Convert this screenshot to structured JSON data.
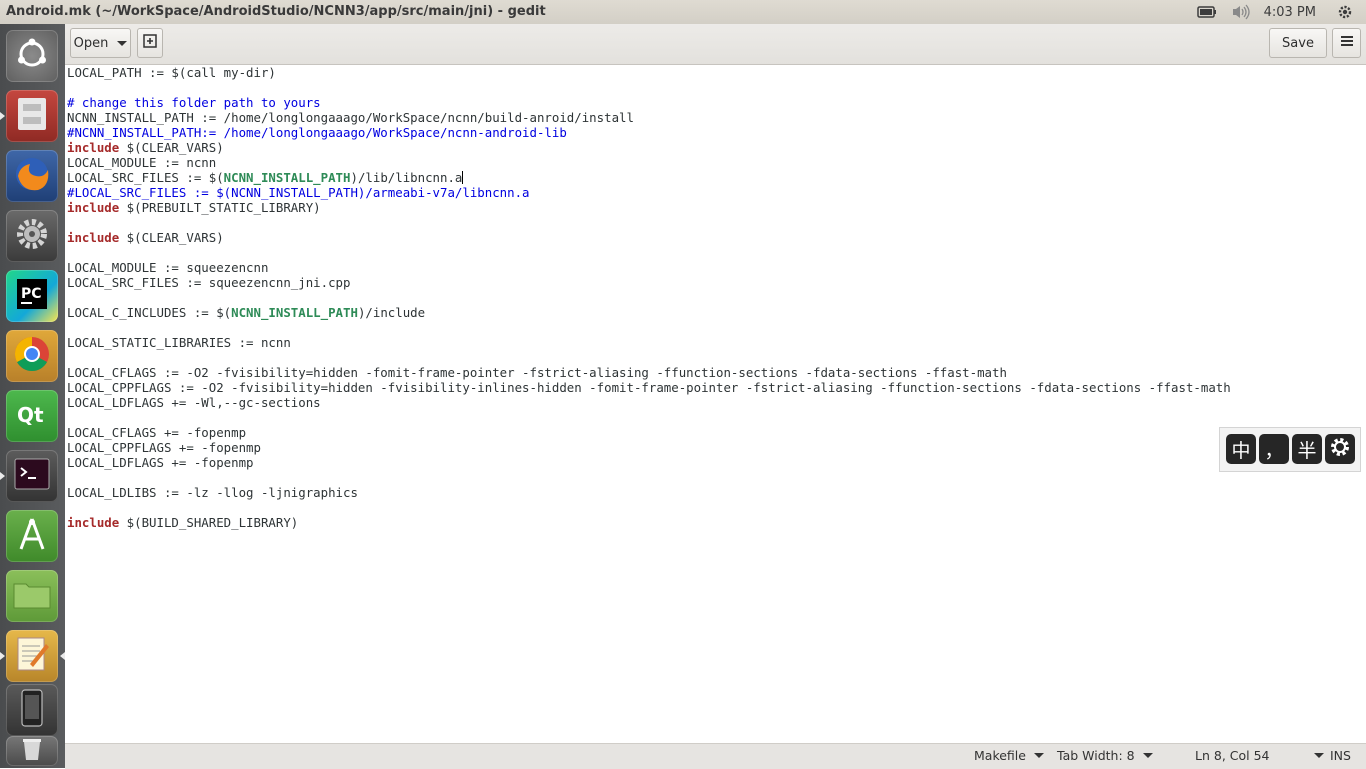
{
  "window": {
    "title": "Android.mk (~/WorkSpace/AndroidStudio/NCNN3/app/src/main/jni) - gedit"
  },
  "top_panel": {
    "clock": "4:03 PM",
    "tray_icons": [
      "battery-icon",
      "volume-icon",
      "settings-icon"
    ]
  },
  "launcher": {
    "items": [
      "ubuntu-dash",
      "files-archive",
      "firefox",
      "system-settings",
      "pycharm",
      "chrome",
      "qt-creator",
      "terminal",
      "android-studio",
      "files",
      "gedit",
      "android-device",
      "trash"
    ]
  },
  "toolbar": {
    "open_label": "Open",
    "save_label": "Save"
  },
  "editor": {
    "lines": [
      [
        {
          "t": "LOCAL_PATH := $(call my-dir)"
        }
      ],
      [
        {
          "t": ""
        }
      ],
      [
        {
          "t": "# change this folder path to yours",
          "c": "cm"
        }
      ],
      [
        {
          "t": "NCNN_INSTALL_PATH := /home/longlongaaago/WorkSpace/ncnn/build-anroid/install"
        }
      ],
      [
        {
          "t": "#NCNN_INSTALL_PATH:= /home/longlongaaago/WorkSpace/ncnn-android-lib",
          "c": "cm"
        }
      ],
      [
        {
          "t": "include",
          "c": "kw"
        },
        {
          "t": " $(CLEAR_VARS)"
        }
      ],
      [
        {
          "t": "LOCAL_MODULE := ncnn"
        }
      ],
      [
        {
          "t": "LOCAL_SRC_FILES := $("
        },
        {
          "t": "NCNN_INSTALL_PATH",
          "c": "var"
        },
        {
          "t": ")/lib/libncnn.a"
        },
        {
          "cursor": true
        }
      ],
      [
        {
          "t": "#LOCAL_SRC_FILES := $(NCNN_INSTALL_PATH)/armeabi-v7a/libncnn.a",
          "c": "cm"
        }
      ],
      [
        {
          "t": "include",
          "c": "kw"
        },
        {
          "t": " $(PREBUILT_STATIC_LIBRARY)"
        }
      ],
      [
        {
          "t": ""
        }
      ],
      [
        {
          "t": "include",
          "c": "kw"
        },
        {
          "t": " $(CLEAR_VARS)"
        }
      ],
      [
        {
          "t": ""
        }
      ],
      [
        {
          "t": "LOCAL_MODULE := squeezencnn"
        }
      ],
      [
        {
          "t": "LOCAL_SRC_FILES := squeezencnn_jni.cpp"
        }
      ],
      [
        {
          "t": ""
        }
      ],
      [
        {
          "t": "LOCAL_C_INCLUDES := $("
        },
        {
          "t": "NCNN_INSTALL_PATH",
          "c": "var"
        },
        {
          "t": ")/include"
        }
      ],
      [
        {
          "t": ""
        }
      ],
      [
        {
          "t": "LOCAL_STATIC_LIBRARIES := ncnn"
        }
      ],
      [
        {
          "t": ""
        }
      ],
      [
        {
          "t": "LOCAL_CFLAGS := -O2 -fvisibility=hidden -fomit-frame-pointer -fstrict-aliasing -ffunction-sections -fdata-sections -ffast-math"
        }
      ],
      [
        {
          "t": "LOCAL_CPPFLAGS := -O2 -fvisibility=hidden -fvisibility-inlines-hidden -fomit-frame-pointer -fstrict-aliasing -ffunction-sections -fdata-sections -ffast-math"
        }
      ],
      [
        {
          "t": "LOCAL_LDFLAGS += -Wl,--gc-sections"
        }
      ],
      [
        {
          "t": ""
        }
      ],
      [
        {
          "t": "LOCAL_CFLAGS += -fopenmp"
        }
      ],
      [
        {
          "t": "LOCAL_CPPFLAGS += -fopenmp"
        }
      ],
      [
        {
          "t": "LOCAL_LDFLAGS += -fopenmp"
        }
      ],
      [
        {
          "t": ""
        }
      ],
      [
        {
          "t": "LOCAL_LDLIBS := -lz -llog -ljnigraphics"
        }
      ],
      [
        {
          "t": ""
        }
      ],
      [
        {
          "t": "include",
          "c": "kw"
        },
        {
          "t": " $(BUILD_SHARED_LIBRARY)"
        }
      ]
    ]
  },
  "ime": {
    "buttons": [
      "中",
      "，",
      "半"
    ]
  },
  "statusbar": {
    "language": "Makefile",
    "tab_width": "Tab Width: 8",
    "position": "Ln 8, Col 54",
    "mode": "INS"
  }
}
